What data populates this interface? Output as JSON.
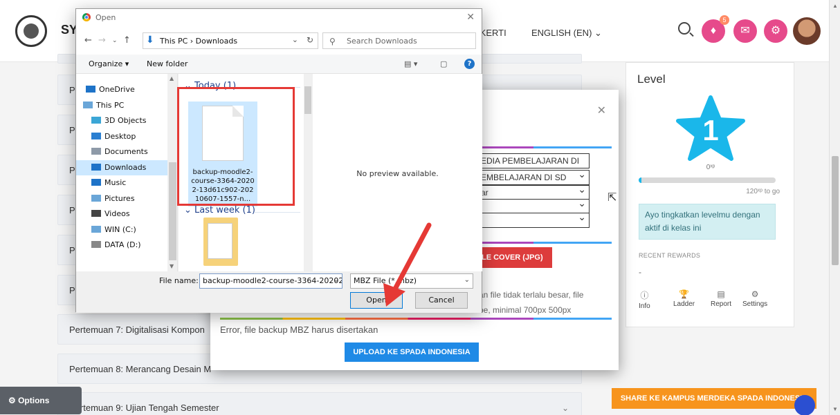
{
  "header": {
    "site_name": "SY",
    "nav": [
      "EKERTI",
      "ENGLISH (EN) ⌄"
    ],
    "notification_count": "5"
  },
  "courses": [
    {
      "label": "P",
      "chevron": ""
    },
    {
      "label": "P",
      "chevron": "⌄"
    },
    {
      "label": "P",
      "chevron": ""
    },
    {
      "label": "P",
      "chevron": ""
    },
    {
      "label": "P",
      "chevron": ""
    },
    {
      "label": "P",
      "chevron": ""
    },
    {
      "label": "P",
      "chevron": ""
    },
    {
      "label": "Pertemuan 7: Digitalisasi Kompon",
      "chevron": ""
    },
    {
      "label": "Pertemuan 8: Merancang Desain M",
      "chevron": ""
    },
    {
      "label": "Pertemuan 9: Ujian Tengah Semester",
      "chevron": "⌄"
    }
  ],
  "level_panel": {
    "title": "Level",
    "level": "1",
    "xp": "0ˣᵖ",
    "xp_progress": 0.02,
    "to_go": "120ˣᵖ to go",
    "hint": "Ayo tingkatkan levelmu dengan aktif di kelas ini",
    "recent_rewards_title": "RECENT REWARDS",
    "recent_rewards_value": "-",
    "tabs": [
      {
        "icon": "ⓘ",
        "label": "Info"
      },
      {
        "icon": "🏆",
        "label": "Ladder"
      },
      {
        "icon": "▤",
        "label": "Report"
      },
      {
        "icon": "⚙",
        "label": "Settings"
      }
    ]
  },
  "share_button": "SHARE KE KAMPUS MERDEKA SPADA INDONESIA",
  "options_button": "Options",
  "modal": {
    "fields": [
      "EDIA PEMBELAJARAN DI",
      "EMBELAJARAN DI SD",
      "ar",
      "",
      ""
    ],
    "cover_button": "LE COVER (JPG)",
    "note_line1": "an file tidak terlalu besar, file",
    "note_line2": "be, minimal 700px 500px",
    "error": "Error, file backup MBZ harus disertakan",
    "upload_button": "UPLOAD KE SPADA INDONESIA"
  },
  "dialog": {
    "title": "Open",
    "path": "This PC  ›  Downloads",
    "search_placeholder": "Search Downloads",
    "organize": "Organize ▾",
    "new_folder": "New folder",
    "tree": [
      {
        "label": "OneDrive",
        "icon": "cloud-icon",
        "color": "#1e73c8",
        "indent": 14
      },
      {
        "label": "This PC",
        "icon": "computer-icon",
        "color": "#6aa6d8",
        "indent": 10
      },
      {
        "label": "3D Objects",
        "icon": "3d-objects-icon",
        "color": "#3ba6d6",
        "indent": 22
      },
      {
        "label": "Desktop",
        "icon": "desktop-icon",
        "color": "#2b7fd1",
        "indent": 22
      },
      {
        "label": "Documents",
        "icon": "documents-icon",
        "color": "#8e9aa8",
        "indent": 22
      },
      {
        "label": "Downloads",
        "icon": "downloads-icon",
        "color": "#1e73c8",
        "indent": 22
      },
      {
        "label": "Music",
        "icon": "music-icon",
        "color": "#1e73c8",
        "indent": 22
      },
      {
        "label": "Pictures",
        "icon": "pictures-icon",
        "color": "#6aa6d8",
        "indent": 22
      },
      {
        "label": "Videos",
        "icon": "videos-icon",
        "color": "#444444",
        "indent": 22
      },
      {
        "label": "WIN (C:)",
        "icon": "drive-icon",
        "color": "#6aa6d8",
        "indent": 22
      },
      {
        "label": "DATA (D:)",
        "icon": "drive-icon",
        "color": "#888888",
        "indent": 22
      }
    ],
    "active_tree_index": 5,
    "group_today": "Today (1)",
    "group_last_week": "Last week (1)",
    "selected_file": "backup-moodle2-course-3364-20202-13d61c902-20210607-1557-n...",
    "preview_text": "No preview available.",
    "file_name_label": "File name:",
    "file_name_value": "backup-moodle2-course-3364-20202",
    "file_type": "MBZ File (*.mbz)",
    "open_button": "Open",
    "cancel_button": "Cancel"
  }
}
